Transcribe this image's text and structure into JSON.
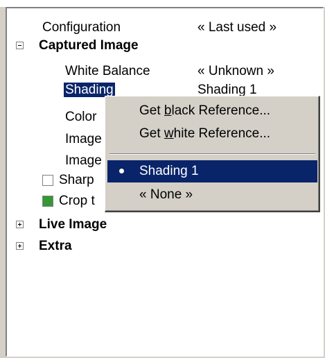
{
  "tree": {
    "configuration": {
      "label": "Configuration",
      "value": "« Last used »"
    },
    "captured_image": {
      "label": "Captured Image",
      "expanded": true
    },
    "white_balance": {
      "label": "White Balance",
      "value": "« Unknown »"
    },
    "shading": {
      "label": "Shading",
      "value": "Shading 1"
    },
    "color": {
      "label": "Color"
    },
    "image1": {
      "label": "Image"
    },
    "image2": {
      "label": "Image"
    },
    "sharp": {
      "label": "Sharp",
      "checked": false,
      "swatch_color": "#ffffff"
    },
    "crop": {
      "label": "Crop t",
      "swatch_color": "#339933"
    },
    "live_image": {
      "label": "Live Image",
      "expanded": false
    },
    "extra": {
      "label": "Extra",
      "expanded": false
    }
  },
  "context_menu": {
    "items": [
      {
        "prefix": "Get ",
        "accel": "b",
        "suffix": "lack Reference..."
      },
      {
        "prefix": "Get ",
        "accel": "w",
        "suffix": "hite Reference..."
      },
      {
        "label": "Shading 1",
        "selected": true,
        "highlighted": true
      },
      {
        "label": "« None »"
      }
    ]
  },
  "colors": {
    "selection": "#0a246a",
    "face": "#d4d0c8"
  }
}
